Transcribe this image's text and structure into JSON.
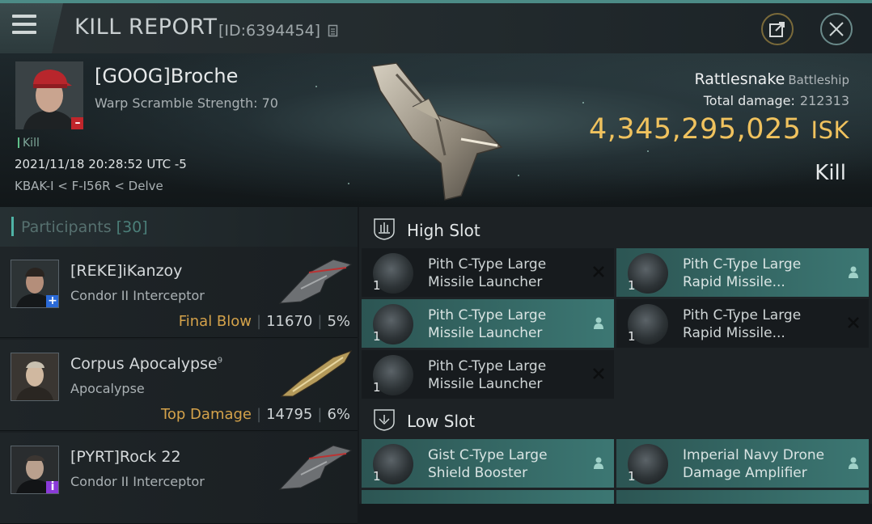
{
  "header": {
    "title": "KILL REPORT",
    "id": "[ID:6394454]"
  },
  "victim": {
    "name": "[GOOG]Broche",
    "warp_scramble": "Warp Scramble Strength: 70",
    "kill_tag": "Kill",
    "timestamp": "2021/11/18 20:28:52 UTC -5",
    "location": "KBAK-I < F-I56R < Delve",
    "ship_name": "Rattlesnake",
    "ship_class": "Battleship",
    "total_damage_label": "Total damage:",
    "total_damage": "212313",
    "isk_value": "4,345,295,025",
    "isk_unit": "ISK",
    "kill_type": "Kill",
    "standing_badge": "–"
  },
  "participants": {
    "label": "Participants",
    "count": "[30]",
    "rows": [
      {
        "name": "[REKE]iKanzoy",
        "superscript": "",
        "ship": "Condor II Interceptor",
        "role": "Final Blow",
        "damage": "11670",
        "percent": "5%",
        "badge": "+",
        "badge_color": "#2a6ad8"
      },
      {
        "name": "Corpus Apocalypse",
        "superscript": "9",
        "ship": "Apocalypse",
        "role": "Top Damage",
        "damage": "14795",
        "percent": "6%",
        "badge": "",
        "badge_color": ""
      },
      {
        "name": "[PYRT]Rock 22",
        "superscript": "",
        "ship": "Condor II Interceptor",
        "role": "",
        "damage": "",
        "percent": "",
        "badge": "i",
        "badge_color": "#8a3ad8"
      }
    ]
  },
  "fitting": {
    "high_slot": {
      "label": "High Slot",
      "modules": [
        {
          "qty": "1",
          "name": "Pith C-Type Large Missile Launcher",
          "state": "destroyed"
        },
        {
          "qty": "1",
          "name": "Pith C-Type Large Rapid Missile...",
          "state": "dropped"
        },
        {
          "qty": "1",
          "name": "Pith C-Type Large Missile Launcher",
          "state": "dropped"
        },
        {
          "qty": "1",
          "name": "Pith C-Type Large Rapid Missile...",
          "state": "destroyed"
        },
        {
          "qty": "1",
          "name": "Pith C-Type Large Missile Launcher",
          "state": "destroyed"
        }
      ]
    },
    "low_slot": {
      "label": "Low Slot",
      "modules": [
        {
          "qty": "1",
          "name": "Gist C-Type Large Shield Booster",
          "state": "dropped"
        },
        {
          "qty": "1",
          "name": "Imperial Navy Drone Damage Amplifier",
          "state": "dropped"
        }
      ]
    }
  },
  "colors": {
    "accent_teal": "#3c7773",
    "isk_gold": "#f0c25e",
    "role_orange": "#d4a24a"
  }
}
